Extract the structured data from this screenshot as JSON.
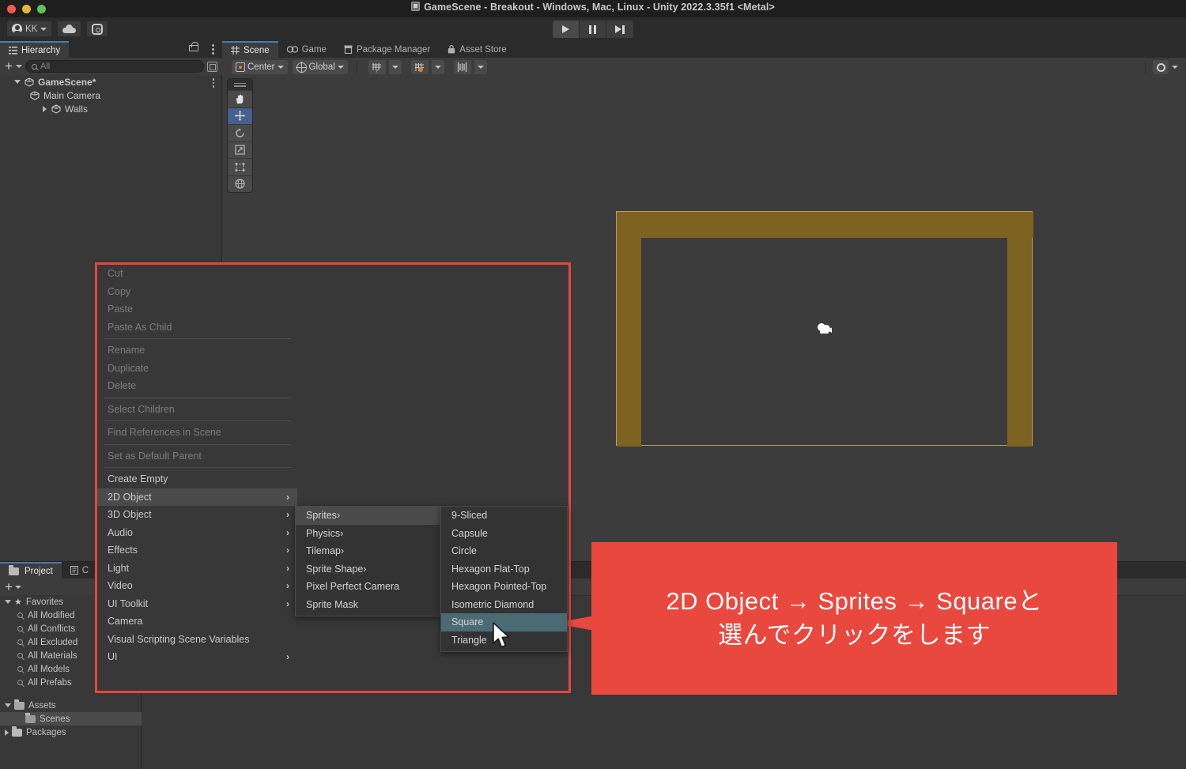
{
  "window": {
    "title": "GameScene - Breakout - Windows, Mac, Linux - Unity 2022.3.35f1 <Metal>",
    "title_icon": "unity-scene-icon"
  },
  "toolbar": {
    "account_label": "KK",
    "account_icon": "account-icon",
    "cloud_icon": "cloud-icon",
    "settings_icon": "gear-icon",
    "play_icon": "play-icon",
    "pause_icon": "pause-icon",
    "step_icon": "step-icon"
  },
  "hierarchy": {
    "tab_label": "Hierarchy",
    "tab_icon": "hierarchy-icon",
    "lock_icon": "lock-icon",
    "menu_icon": "kebab-icon",
    "add_label": "+",
    "search_placeholder": "All",
    "search_icon": "search-icon",
    "filter_icon": "sub-scene-filter-icon",
    "items": [
      {
        "label": "GameScene*",
        "depth": 0,
        "expanded": true,
        "icon": "scene-icon"
      },
      {
        "label": "Main Camera",
        "depth": 1,
        "expanded": null,
        "icon": "gameobject-icon"
      },
      {
        "label": "Walls",
        "depth": 1,
        "expanded": false,
        "icon": "gameobject-icon"
      }
    ]
  },
  "scene_panel": {
    "tabs": [
      {
        "label": "Scene",
        "icon": "grid-icon",
        "active": true
      },
      {
        "label": "Game",
        "icon": "gamepad-icon",
        "active": false
      },
      {
        "label": "Package Manager",
        "icon": "package-icon",
        "active": false
      },
      {
        "label": "Asset Store",
        "icon": "store-icon",
        "active": false
      }
    ],
    "toolbar": {
      "pivot_label": "Center",
      "pivot_icon": "pivot-icon",
      "handle_label": "Global",
      "handle_icon": "globe-icon",
      "grid_axis_icon": "grid-axis-icon",
      "grid_snap_icon": "grid-snap-icon",
      "layers_icon": "layers-icon",
      "dropdown_icon": "chevron-down-icon",
      "gizmo_toggle_icon": "gizmo-circle-icon"
    },
    "tools": [
      {
        "name": "hand-tool",
        "selected": false
      },
      {
        "name": "move-tool",
        "selected": true
      },
      {
        "name": "rotate-tool",
        "selected": false
      },
      {
        "name": "scale-tool",
        "selected": false
      },
      {
        "name": "rect-tool",
        "selected": false
      },
      {
        "name": "transform-tool",
        "selected": false
      }
    ],
    "content": {
      "walls_color": "#7d6221",
      "walls_outline": "#b9a05f",
      "camera_gizmo_icon": "camera-gizmo-icon"
    }
  },
  "project_panel": {
    "tabs": [
      {
        "label": "Project",
        "icon": "folder-icon",
        "active": true
      },
      {
        "label": "C",
        "icon": "console-icon",
        "active": false
      }
    ],
    "add_label": "+",
    "items": [
      {
        "label": "Favorites",
        "type": "favorites",
        "depth": 0,
        "expanded": true
      },
      {
        "label": "All Modified",
        "type": "search",
        "depth": 1
      },
      {
        "label": "All Conflicts",
        "type": "search",
        "depth": 1
      },
      {
        "label": "All Excluded",
        "type": "search",
        "depth": 1
      },
      {
        "label": "All Materials",
        "type": "search",
        "depth": 1
      },
      {
        "label": "All Models",
        "type": "search",
        "depth": 1
      },
      {
        "label": "All Prefabs",
        "type": "search",
        "depth": 1
      },
      {
        "label": "Assets",
        "type": "folder-open",
        "depth": 0,
        "expanded": true
      },
      {
        "label": "Scenes",
        "type": "folder",
        "depth": 1,
        "selected": true
      },
      {
        "label": "Packages",
        "type": "folder",
        "depth": 0,
        "expanded": false
      }
    ]
  },
  "context_menu": {
    "highlight_color": "#e8453c",
    "items": [
      {
        "label": "Cut",
        "disabled": true,
        "submenu": false
      },
      {
        "label": "Copy",
        "disabled": true,
        "submenu": false
      },
      {
        "label": "Paste",
        "disabled": true,
        "submenu": false
      },
      {
        "label": "Paste As Child",
        "disabled": true,
        "submenu": false
      },
      {
        "separator": true
      },
      {
        "label": "Rename",
        "disabled": true,
        "submenu": false
      },
      {
        "label": "Duplicate",
        "disabled": true,
        "submenu": false
      },
      {
        "label": "Delete",
        "disabled": true,
        "submenu": false
      },
      {
        "separator": true
      },
      {
        "label": "Select Children",
        "disabled": true,
        "submenu": false
      },
      {
        "separator": true
      },
      {
        "label": "Find References in Scene",
        "disabled": true,
        "submenu": false
      },
      {
        "separator": true
      },
      {
        "label": "Set as Default Parent",
        "disabled": true,
        "submenu": false
      },
      {
        "separator": true
      },
      {
        "label": "Create Empty",
        "disabled": false,
        "submenu": false
      },
      {
        "label": "2D Object",
        "disabled": false,
        "submenu": true,
        "highlighted": true
      },
      {
        "label": "3D Object",
        "disabled": false,
        "submenu": true
      },
      {
        "label": "Audio",
        "disabled": false,
        "submenu": true
      },
      {
        "label": "Effects",
        "disabled": false,
        "submenu": true
      },
      {
        "label": "Light",
        "disabled": false,
        "submenu": true
      },
      {
        "label": "Video",
        "disabled": false,
        "submenu": true
      },
      {
        "label": "UI Toolkit",
        "disabled": false,
        "submenu": true
      },
      {
        "label": "Camera",
        "disabled": false,
        "submenu": false
      },
      {
        "label": "Visual Scripting Scene Variables",
        "disabled": false,
        "submenu": false
      },
      {
        "label": "UI",
        "disabled": false,
        "submenu": true
      }
    ]
  },
  "submenu_2d": {
    "items": [
      {
        "label": "Sprites",
        "submenu": true,
        "highlighted": true
      },
      {
        "label": "Physics",
        "submenu": true
      },
      {
        "label": "Tilemap",
        "submenu": true
      },
      {
        "label": "Sprite Shape",
        "submenu": true
      },
      {
        "label": "Pixel Perfect Camera",
        "submenu": false
      },
      {
        "label": "Sprite Mask",
        "submenu": false
      }
    ]
  },
  "submenu_sprites": {
    "items": [
      {
        "label": "9-Sliced",
        "selected": false
      },
      {
        "label": "Capsule",
        "selected": false
      },
      {
        "label": "Circle",
        "selected": false
      },
      {
        "label": "Hexagon Flat-Top",
        "selected": false
      },
      {
        "label": "Hexagon Pointed-Top",
        "selected": false
      },
      {
        "label": "Isometric Diamond",
        "selected": false
      },
      {
        "label": "Square",
        "selected": true
      },
      {
        "label": "Triangle",
        "selected": false
      }
    ]
  },
  "callout": {
    "background": "#e8483e",
    "line1": "2D Object → Sprites → Squareと",
    "line2": "選んでクリックをします"
  },
  "cursor": {
    "icon": "mouse-pointer-icon"
  }
}
